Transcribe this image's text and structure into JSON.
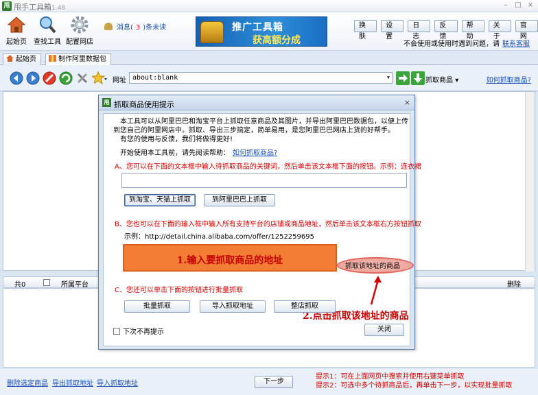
{
  "app": {
    "title": "甩手工具箱",
    "version": "1.48",
    "icon_text": "甩"
  },
  "window_controls": {
    "minimize": "–",
    "maximize": "□",
    "close": "×"
  },
  "toolbar": {
    "home": "起始页",
    "find": "查找工具",
    "config": "配置网店",
    "msg_prefix": "消息(",
    "msg_count": "3",
    "msg_suffix": ")条未读"
  },
  "banner": {
    "line1": "推广工具箱",
    "line2": "获高额分成"
  },
  "top_buttons": [
    "换肤",
    "设置",
    "日志",
    "反馈",
    "帮助",
    "关于",
    "官网"
  ],
  "notice": {
    "text": "不会使用或使用时遇到问题，请",
    "link": "联系客服"
  },
  "tabs": [
    "起始页",
    "制作阿里数据包"
  ],
  "nav": {
    "address_label": "网址",
    "url": "about:blank",
    "grab_label": "抓取商品",
    "how_link": "如何抓取商品?"
  },
  "list": {
    "total": "共0",
    "platform": "所属平台",
    "delete": "删除"
  },
  "bottom": {
    "delete_selected": "删除选定商品",
    "export": "导出抓取地址",
    "import": "导入抓取地址",
    "next": "下一步",
    "tip1": "提示1：可在上面网页中搜索并使用右键菜单抓取",
    "tip2": "提示2：可选中多个待抓商品后，再单击下一步，以实现批量抓取"
  },
  "dialog": {
    "title": "抓取商品使用提示",
    "close": "×",
    "intro1": "本工具可以从阿里巴巴和淘宝平台上抓取任意商品及其图片，并导出阿里巴巴数据包，以便上传到您自己的阿里网店中。抓取、导出三步搞定，简单易用，是您阿里巴巴网店上货的好帮手。",
    "intro2": "有您的使用与反馈，我们将做得更好!",
    "help_text": "开始使用本工具前，请先阅读帮助：",
    "help_link": "如何抓取商品?",
    "sec_a": "A、您可以在下面的文本框中输入待抓取商品的关键词，然后单击该文本框下面的按钮。示例：连衣裙",
    "btn_taobao": "到淘宝、天猫上抓取",
    "btn_alibaba": "到阿里巴巴上抓取",
    "sec_b": "B、您也可以在下面的输入框中输入所有支持平台的店铺或商品地址，然后单击该文本框右方按钮抓取",
    "example": "示例：http://detail.china.alibaba.com/offer/1252259695",
    "step1": "1.输入要抓取商品的地址",
    "grab_addr": "抓取该地址的商品",
    "sec_c": "C、您还可以单击下面的按钮进行批量抓取",
    "step2": "2.点击抓取该地址的商品",
    "btn_batch": "批量抓取",
    "btn_import": "导入抓取地址",
    "btn_shop": "整店抓取",
    "no_more": "下次不再提示",
    "btn_close": "关闭"
  }
}
